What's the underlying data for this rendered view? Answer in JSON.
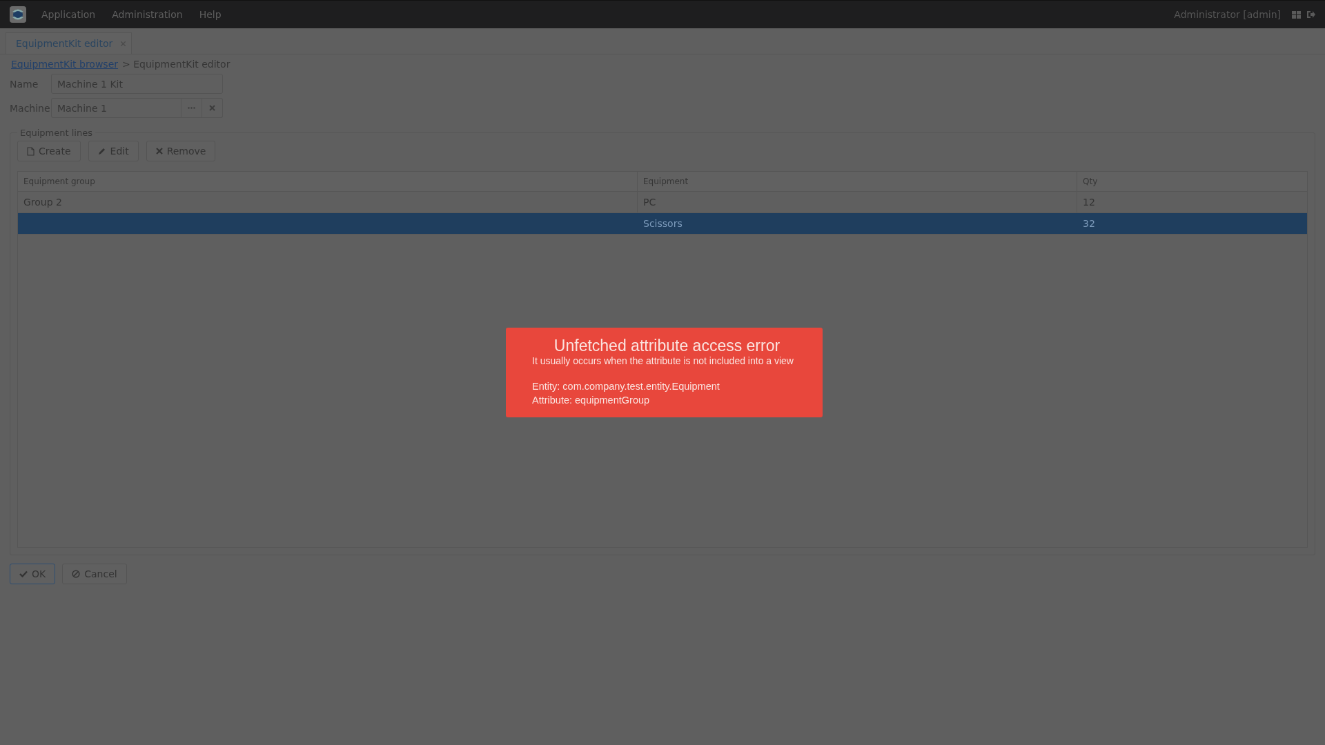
{
  "menu_bar": {
    "items": [
      "Application",
      "Administration",
      "Help"
    ],
    "user": "Administrator [admin]"
  },
  "tab": {
    "label": "EquipmentKit editor"
  },
  "breadcrumb": {
    "link": "EquipmentKit browser",
    "current": "> EquipmentKit editor"
  },
  "fields": [
    {
      "label": "Name",
      "value": "Machine 1 Kit",
      "kind": "text"
    },
    {
      "label": "Machine",
      "value": "Machine 1",
      "kind": "picker"
    }
  ],
  "equipment_lines": {
    "legend": "Equipment lines",
    "buttons": [
      {
        "label": "Create",
        "kind": "create"
      },
      {
        "label": "Edit",
        "kind": "edit"
      },
      {
        "label": "Remove",
        "kind": "remove"
      }
    ],
    "table": {
      "columns": [
        "Equipment group",
        "Equipment",
        "Qty"
      ],
      "rows": [
        {
          "equipment_group": "Group 2",
          "equipment": "PC",
          "qty": "12",
          "selected": false
        },
        {
          "equipment": "Scissors",
          "qty": "32",
          "selected": true
        }
      ]
    }
  },
  "footer_buttons": [
    {
      "label": "OK",
      "kind": "ok"
    },
    {
      "label": "Cancel",
      "kind": "cancel"
    }
  ],
  "notification": {
    "title": "Unfetched attribute access error",
    "subtitle": "It usually occurs when the attribute is not included into a view",
    "lines": [
      "Entity: com.company.test.entity.Equipment",
      "Attribute: equipmentGroup"
    ]
  }
}
